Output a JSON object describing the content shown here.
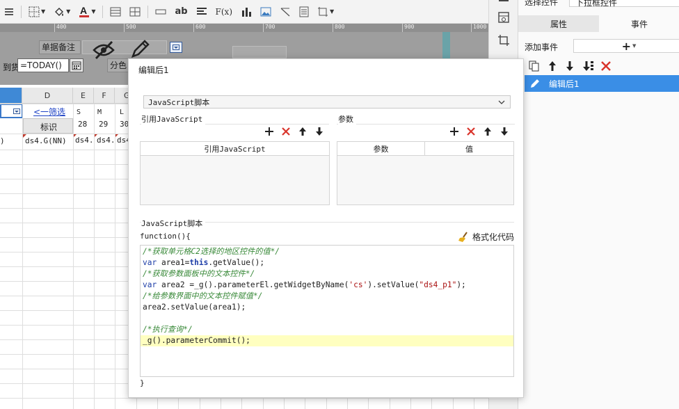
{
  "toolbar": {
    "format_text_label": "ab",
    "formula_label": "F(x)",
    "icons": [
      "list-format-icon",
      "border-icon",
      "fill-color-icon",
      "font-color-icon",
      "insert-row-icon",
      "merge-cells-icon",
      "text-field-icon",
      "text-label-icon",
      "align-icon",
      "formula-icon",
      "chart-icon",
      "image-icon",
      "slash-icon",
      "richtext-icon",
      "frame-icon"
    ]
  },
  "ruler": {
    "ticks": [
      "400",
      "500",
      "600",
      "700",
      "800",
      "900",
      "1000"
    ]
  },
  "param_pane": {
    "label_note": "单据备注",
    "label_date": "到货",
    "date_value": "=TODAY()",
    "label_color": "分色"
  },
  "grid": {
    "columns": [
      "D",
      "E",
      "F",
      "G"
    ],
    "filter_link": "<一筛选",
    "tag_label": "标识",
    "sub_headers": [
      {
        "top": "S",
        "bottom": "28"
      },
      {
        "top": "M",
        "bottom": "29"
      },
      {
        "top": "L",
        "bottom": "30"
      }
    ],
    "row_values": {
      "first": ")",
      "d": "ds4.G(NN)",
      "e": "ds4.",
      "f": "ds4.",
      "g": "ds4"
    }
  },
  "right_panel": {
    "top_left": "选择控件",
    "top_right": "下拉框控件",
    "tab_properties": "属性",
    "tab_events": "事件",
    "add_event_label": "添加事件",
    "add_symbol": "+",
    "event_item": "编辑后1"
  },
  "dialog": {
    "title": "编辑后1",
    "type_value": "JavaScript脚本",
    "ref_section_label": "引用JavaScript",
    "params_section_label": "参数",
    "ref_table_header": "引用JavaScript",
    "params_header_param": "参数",
    "params_header_value": "值",
    "script_section_label": "JavaScript脚本",
    "function_open": "function(){",
    "function_close": "}",
    "format_button": "格式化代码"
  },
  "code": {
    "c1": "/*获取单元格C2选择的地区控件的值*/",
    "l2_kw": "var",
    "l2_a": " area1=",
    "l2_this": "this",
    "l2_b": ".getValue();",
    "c3": "/*获取参数面板中的文本控件*/",
    "l4_kw": "var",
    "l4_a": " area2 =_g().parameterEl.getWidgetByName(",
    "l4_s1": "'cs'",
    "l4_b": ").setValue(",
    "l4_s2": "\"ds4_p1\"",
    "l4_c": ");",
    "c5": "/*给参数界面中的文本控件赋值*/",
    "l6": "area2.setValue(area1);",
    "c8": "/*执行查询*/",
    "l9": "_g().parameterCommit();"
  }
}
